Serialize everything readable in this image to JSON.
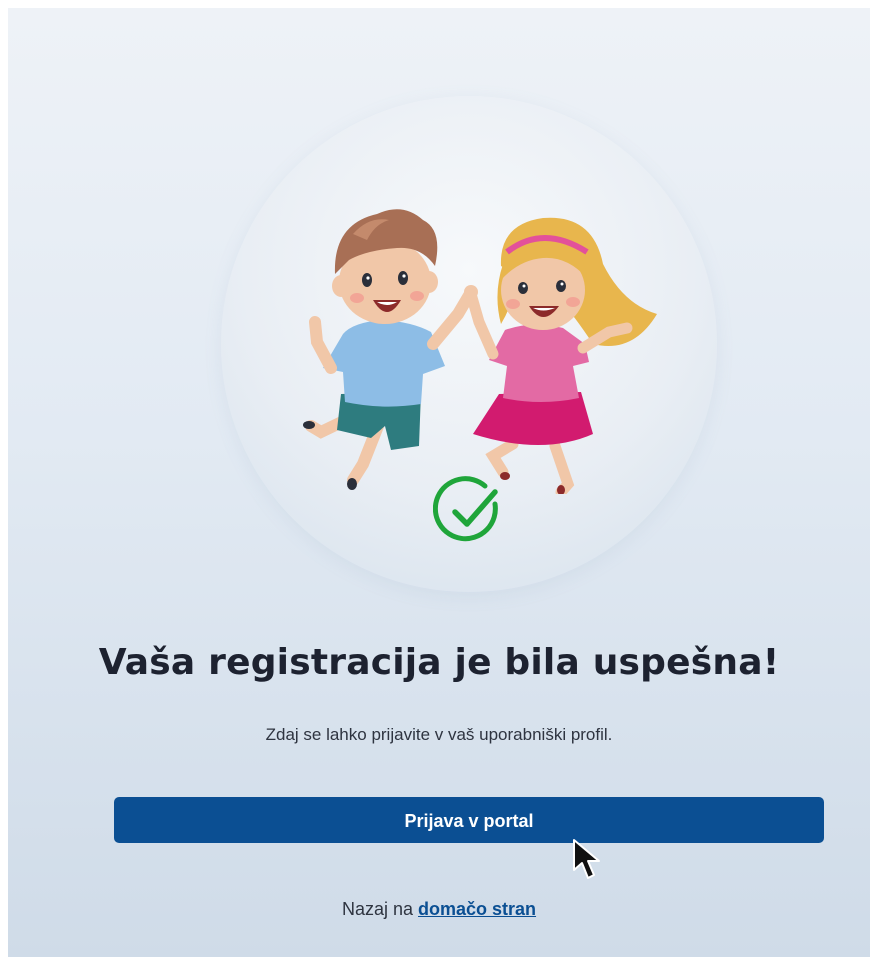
{
  "success": {
    "title": "Vaša registracija je bila uspešna!",
    "subtitle": "Zdaj se lahko prijavite v vaš uporabniški profil.",
    "login_button": "Prijava v portal",
    "back_prefix": "Nazaj na",
    "back_link": "domačo stran"
  },
  "icons": {
    "illustration": "jumping-kids-illustration",
    "check": "check-circle-icon",
    "cursor": "mouse-pointer-icon"
  },
  "colors": {
    "primary": "#0b4f93",
    "success": "#1fa53a",
    "title": "#1d2230"
  }
}
